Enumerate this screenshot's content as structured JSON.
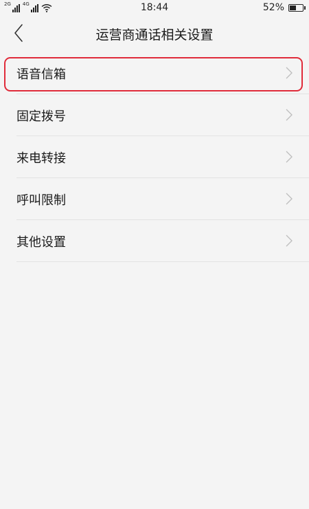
{
  "status_bar": {
    "sim1_tag": "2G",
    "sim2_tag": "4G",
    "time": "18:44",
    "battery_percent": "52%",
    "battery_level": 0.52,
    "icons": [
      "signal-icon",
      "signal-icon",
      "wifi-icon",
      "battery-icon"
    ]
  },
  "header": {
    "back_icon": "chevron-left-icon",
    "title": "运营商通话相关设置"
  },
  "menu": {
    "items": [
      {
        "label": "语音信箱",
        "highlighted": true
      },
      {
        "label": "固定拨号"
      },
      {
        "label": "来电转接"
      },
      {
        "label": "呼叫限制"
      },
      {
        "label": "其他设置"
      }
    ],
    "chevron_icon": "chevron-right-icon"
  },
  "colors": {
    "background": "#f4f4f4",
    "highlight_border": "#e02b3a",
    "divider": "#e2e2e2",
    "chevron": "#bdbdbd"
  }
}
